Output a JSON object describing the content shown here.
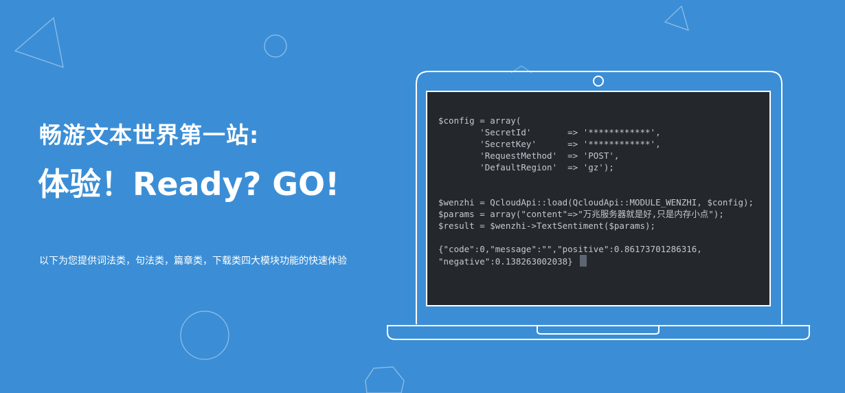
{
  "hero": {
    "title_line1": "畅游文本世界第一站:",
    "title_line2": "体验！Ready? GO!",
    "description": "以下为您提供词法类，句法类，篇章类，下载类四大模块功能的快速体验"
  },
  "code_demo": {
    "lines": [
      "$config = array(",
      "        'SecretId'       => '************',",
      "        'SecretKey'      => '************',",
      "        'RequestMethod'  => 'POST',",
      "        'DefaultRegion'  => 'gz');",
      "",
      "",
      "$wenzhi = QcloudApi::load(QcloudApi::MODULE_WENZHI, $config);",
      "$params = array(\"content\"=>\"万兆服务器就是好,只是内存小点\");",
      "$result = $wenzhi->TextSentiment($params);",
      "",
      "{\"code\":0,\"message\":\"\",\"positive\":0.86173701286316,"
    ],
    "last_line": "\"negative\":0.138263002038}"
  },
  "colors": {
    "background": "#3b8ed6",
    "screen": "#24272c",
    "code_text": "#c4c8cf",
    "outline": "#ffffff"
  }
}
